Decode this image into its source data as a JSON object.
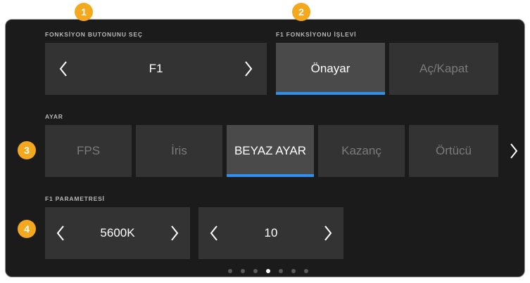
{
  "badges": [
    "1",
    "2",
    "3",
    "4"
  ],
  "function_button_select": {
    "caption": "FONKSİYON BUTONUNU SEÇ",
    "value": "F1"
  },
  "f1_function": {
    "caption": "F1 FONKSİYONU İŞLEVİ",
    "options": [
      {
        "label": "Önayar",
        "selected": true
      },
      {
        "label": "Aç/Kapat",
        "selected": false
      }
    ]
  },
  "setting": {
    "caption": "AYAR",
    "options": [
      {
        "label": "FPS",
        "selected": false
      },
      {
        "label": "İris",
        "selected": false
      },
      {
        "label": "BEYAZ AYAR",
        "selected": true
      },
      {
        "label": "Kazanç",
        "selected": false
      },
      {
        "label": "Örtücü",
        "selected": false
      }
    ]
  },
  "f1_parameter": {
    "caption": "F1 PARAMETRESİ",
    "white_balance": "5600K",
    "tint": "10"
  },
  "pagination": {
    "page_count": 7,
    "current_page": 4
  },
  "colors": {
    "accent": "#2d8ff0",
    "badge": "#f4a81d",
    "panel": "#1b1b1b",
    "tile": "#333333",
    "tile_active": "#4a4a4a"
  }
}
